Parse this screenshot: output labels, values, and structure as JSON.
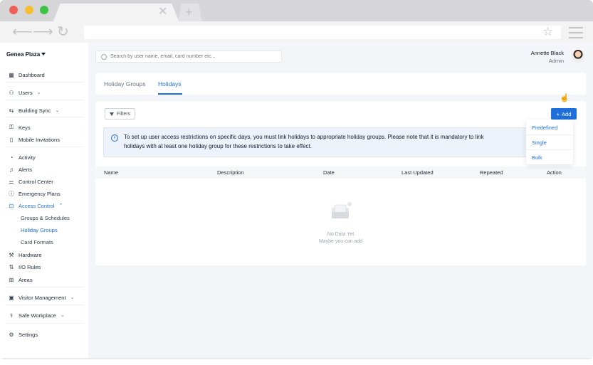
{
  "browser": {
    "address": ""
  },
  "sidebar": {
    "org_name": "Genea Plaza",
    "items": [
      {
        "label": "Dashboard",
        "icon": "dashboard-icon"
      },
      {
        "label": "Users",
        "icon": "users-icon"
      },
      {
        "label": "Building Sync",
        "icon": "building-sync-icon"
      },
      {
        "label": "Keys",
        "icon": "key-icon"
      },
      {
        "label": "Mobile Invitations",
        "icon": "mobile-icon"
      },
      {
        "label": "Activity",
        "icon": "activity-icon"
      },
      {
        "label": "Alerts",
        "icon": "bell-icon"
      },
      {
        "label": "Control Center",
        "icon": "sliders-icon"
      },
      {
        "label": "Emergency Plans",
        "icon": "alert-circle-icon"
      },
      {
        "label": "Access Control",
        "icon": "lock-icon"
      },
      {
        "label": "Hardware",
        "icon": "hammer-icon"
      },
      {
        "label": "I/O Rules",
        "icon": "io-rules-icon"
      },
      {
        "label": "Areas",
        "icon": "areas-icon"
      },
      {
        "label": "Visitor Management",
        "icon": "visitor-icon"
      },
      {
        "label": "Safe Workplace",
        "icon": "safe-workplace-icon"
      },
      {
        "label": "Settings",
        "icon": "gear-icon"
      }
    ],
    "access_control_subitems": [
      "Groups & Schedules",
      "Holiday Groups",
      "Card Formats"
    ]
  },
  "header": {
    "search_placeholder": "Search by user name, email, card number etc...",
    "user_name": "Annette Black",
    "user_role": "Admin"
  },
  "tabs": [
    {
      "label": "Holiday Groups"
    },
    {
      "label": "Holidays"
    }
  ],
  "toolbar": {
    "filters_label": "Filters",
    "add_label": "Add"
  },
  "info_text_line1": "To set up user access restrictions on specific days, you must link holidays to appropriate holiday groups. Please note that it is mandatory to link",
  "info_text_line2": "holidays with at least one holiday group for these restrictions to take effect.",
  "table": {
    "columns": [
      "Name",
      "Description",
      "Date",
      "Last Updated",
      "Repeated",
      "Action"
    ],
    "rows": []
  },
  "empty_state": {
    "title": "No Data Yet",
    "subtitle": "Maybe you can add"
  },
  "add_menu": [
    "Predefined",
    "Single",
    "Bulk"
  ],
  "colors": {
    "accent": "#1e6fd9",
    "background": "#f4f5f8"
  }
}
